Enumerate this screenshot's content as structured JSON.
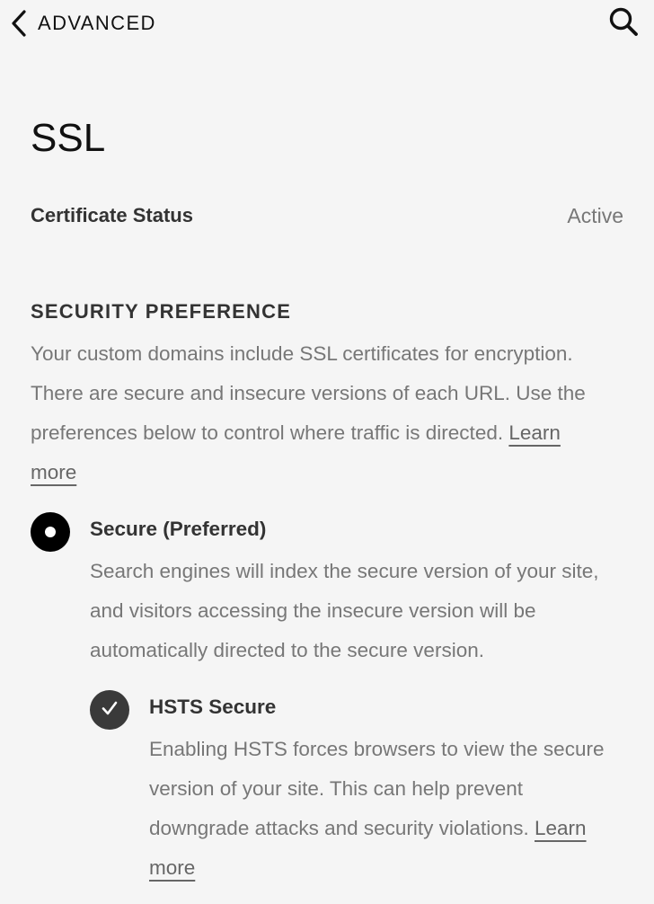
{
  "header": {
    "back_label": "ADVANCED",
    "back_icon": "chevron-left-icon",
    "search_icon": "search-icon"
  },
  "page": {
    "title": "SSL"
  },
  "certificate": {
    "label": "Certificate Status",
    "value": "Active"
  },
  "security": {
    "heading": "SECURITY PREFERENCE",
    "description": "Your custom domains include SSL certificates for encryption. There are secure and insecure versions of each URL. Use the preferences below to control where traffic is directed.",
    "learn_more": "Learn more"
  },
  "secure_option": {
    "title": "Secure (Preferred)",
    "description": "Search engines will index the secure version of your site, and visitors accessing the insecure version will be automatically directed to the secure version.",
    "selected": true
  },
  "hsts": {
    "title": "HSTS Secure",
    "description": "Enabling HSTS forces browsers to view the secure version of your site. This can help prevent downgrade attacks and security violations.",
    "learn_more": "Learn more",
    "checked": true
  },
  "colors": {
    "background": "#f5f5f5",
    "primary_text": "#111111",
    "secondary_text": "#777777",
    "radio_fill": "#000000",
    "check_fill": "#3a3a3a"
  }
}
